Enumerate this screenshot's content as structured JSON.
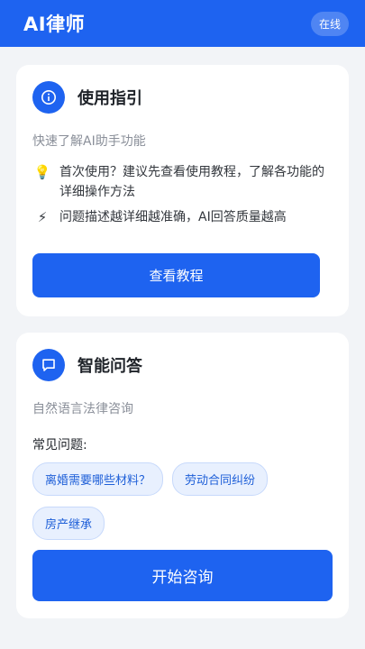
{
  "header": {
    "title": "AI律师",
    "status": "在线"
  },
  "guide_card": {
    "icon": "info-icon",
    "title": "使用指引",
    "subtitle": "快速了解AI助手功能",
    "tips": [
      {
        "icon": "lightbulb-icon",
        "glyph": "💡",
        "text": "首次使用？建议先查看使用教程，了解各功能的详细操作方法"
      },
      {
        "icon": "lightning-icon",
        "glyph": "⚡",
        "text": "问题描述越详细越准确，AI回答质量越高"
      }
    ],
    "button_label": "查看教程"
  },
  "qa_card": {
    "icon": "chat-bubble-icon",
    "title": "智能问答",
    "subtitle": "自然语言法律咨询",
    "faq_label": "常见问题:",
    "faq_chips": [
      "离婚需要哪些材料？",
      "劳动合同纠纷",
      "房产继承"
    ],
    "button_label": "开始咨询"
  },
  "colors": {
    "brand": "#1e63f0",
    "background": "#f2f4f7",
    "chip_bg": "#e8f0fe",
    "chip_text": "#1e5fd8"
  }
}
